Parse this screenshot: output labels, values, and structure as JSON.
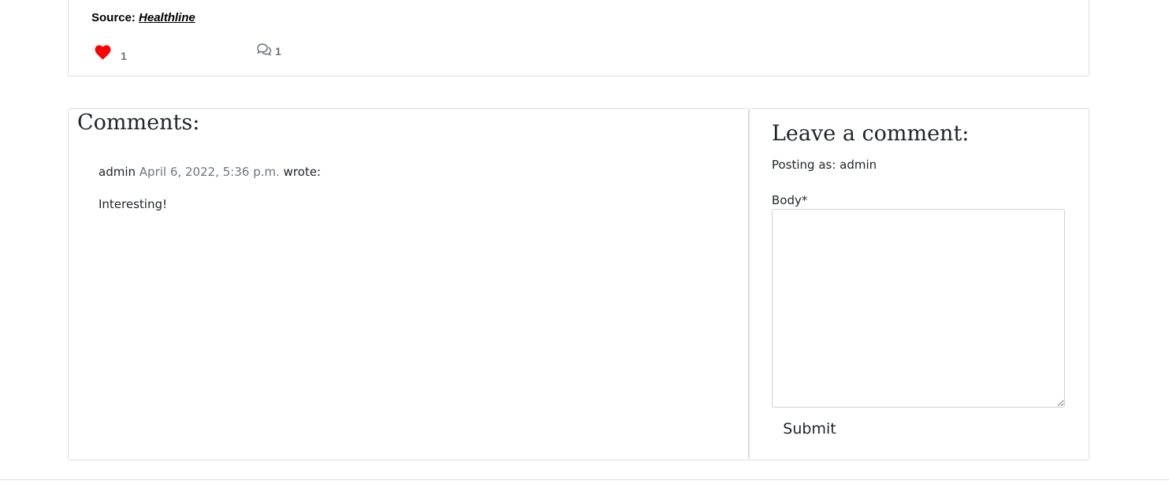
{
  "post": {
    "source_label": "Source:",
    "source_link_text": "Healthline",
    "likes_count": "1",
    "comments_count": "1",
    "colors": {
      "heart": "#ff0000",
      "count": "#6c757d"
    }
  },
  "comments_section": {
    "heading": "Comments:",
    "items": [
      {
        "author": "admin",
        "date": "April 6, 2022, 5:36 p.m.",
        "wrote_label": "wrote:",
        "body": "Interesting!"
      }
    ]
  },
  "comment_form": {
    "heading": "Leave a comment:",
    "posting_as": "Posting as: admin",
    "body_label": "Body*",
    "body_value": "",
    "submit_label": "Submit"
  },
  "icons": {
    "heart": "heart-icon",
    "comments": "comments-icon"
  }
}
